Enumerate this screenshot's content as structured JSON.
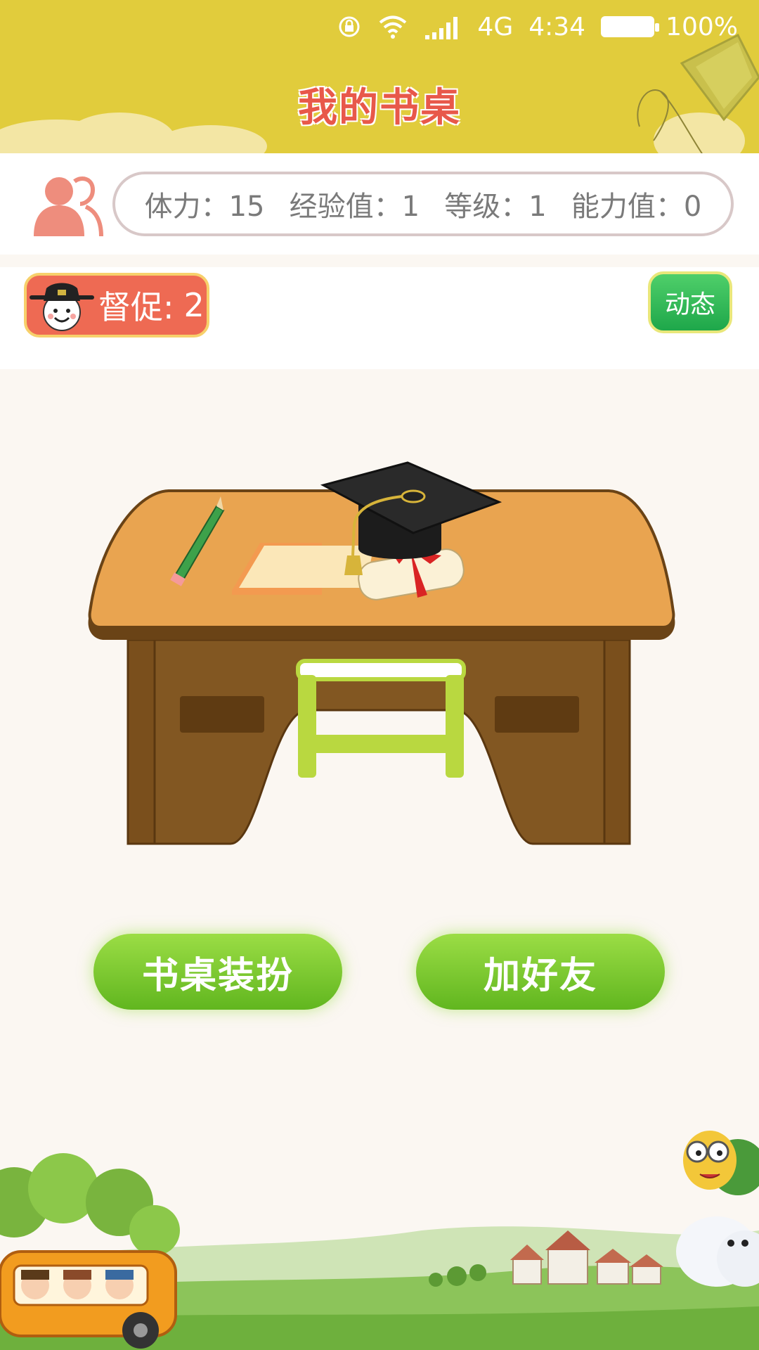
{
  "status_bar": {
    "network": "4G",
    "time": "4:34",
    "battery": "100%",
    "icons": [
      "rotation-lock-icon",
      "wifi-icon",
      "signal-icon",
      "battery-icon"
    ]
  },
  "header": {
    "title": "我的书桌"
  },
  "stats": {
    "icon": "friends-icon",
    "stamina": "体力：15",
    "experience": "经验值：1",
    "level": "等级：1",
    "ability": "能力值：0"
  },
  "urge": {
    "label": "督促:",
    "count": "2",
    "icon": "official-hat-face-icon"
  },
  "dynamic_button": {
    "label": "动态"
  },
  "desk": {
    "items": [
      "pencil-icon",
      "open-book-icon",
      "graduation-cap-icon",
      "diploma-scroll-icon"
    ]
  },
  "buttons": {
    "dress_desk": "书桌装扮",
    "add_friend": "加好友"
  },
  "colors": {
    "header_bg": "#e1cc3c",
    "title": "#e8584a",
    "urge_bg": "#ee6a53",
    "green_button": "#61b61f",
    "desk_top": "#e9a450",
    "desk_body": "#815620"
  }
}
